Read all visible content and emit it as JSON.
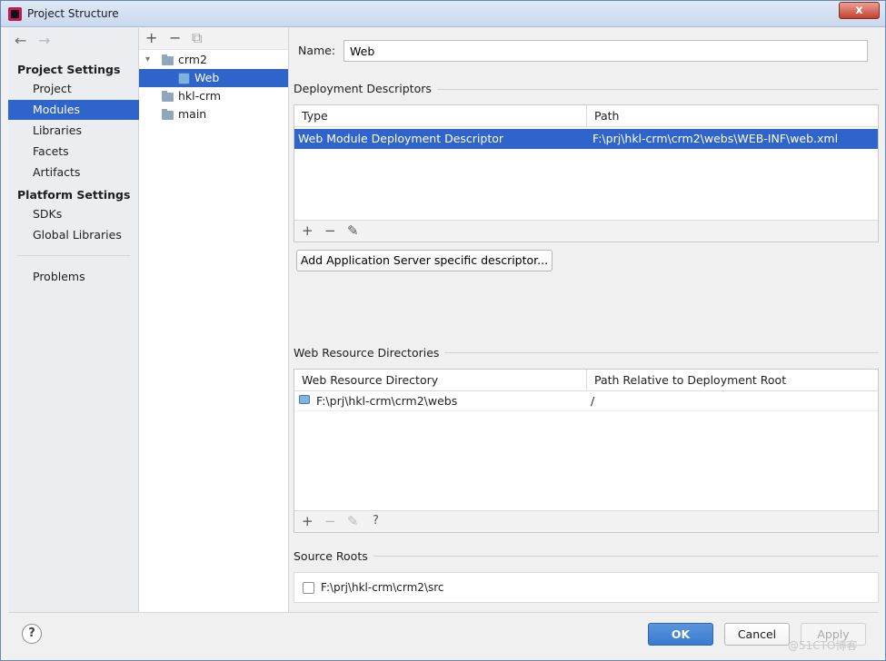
{
  "window": {
    "title": "Project Structure",
    "close_label": "x"
  },
  "nav": {
    "back_icon": "←",
    "forward_icon": "→",
    "sections": [
      {
        "title": "Project Settings",
        "items": [
          {
            "label": "Project",
            "selected": false
          },
          {
            "label": "Modules",
            "selected": true
          },
          {
            "label": "Libraries",
            "selected": false
          },
          {
            "label": "Facets",
            "selected": false
          },
          {
            "label": "Artifacts",
            "selected": false
          }
        ]
      },
      {
        "title": "Platform Settings",
        "items": [
          {
            "label": "SDKs",
            "selected": false
          },
          {
            "label": "Global Libraries",
            "selected": false
          }
        ]
      }
    ],
    "problems_label": "Problems"
  },
  "tree": {
    "toolbar": {
      "add": "+",
      "remove": "−",
      "copy": "⧉"
    },
    "nodes": [
      {
        "label": "crm2",
        "type": "module",
        "expanded": true
      },
      {
        "label": "Web",
        "type": "facet",
        "selected": true
      },
      {
        "label": "hkl-crm",
        "type": "module"
      },
      {
        "label": "main",
        "type": "module"
      }
    ]
  },
  "main": {
    "name_label": "Name:",
    "name_value": "Web",
    "deployment": {
      "title": "Deployment Descriptors",
      "columns": [
        "Type",
        "Path"
      ],
      "rows": [
        {
          "type": "Web Module Deployment Descriptor",
          "path": "F:\\prj\\hkl-crm\\crm2\\webs\\WEB-INF\\web.xml"
        }
      ],
      "toolbar": {
        "add": "+",
        "remove": "−",
        "edit": "✎"
      }
    },
    "add_server_button": "Add Application Server specific descriptor...",
    "web_resources": {
      "title": "Web Resource Directories",
      "columns": [
        "Web Resource Directory",
        "Path Relative to Deployment Root"
      ],
      "rows": [
        {
          "directory": "F:\\prj\\hkl-crm\\crm2\\webs",
          "relative": "/"
        }
      ],
      "toolbar": {
        "add": "+",
        "remove": "−",
        "edit": "✎",
        "help": "?"
      }
    },
    "source_roots": {
      "title": "Source Roots",
      "items": [
        {
          "path": "F:\\prj\\hkl-crm\\crm2\\src",
          "checked": false
        }
      ]
    }
  },
  "footer": {
    "help": "?",
    "ok": "OK",
    "cancel": "Cancel",
    "apply": "Apply"
  },
  "watermark": "@51CTO博客"
}
